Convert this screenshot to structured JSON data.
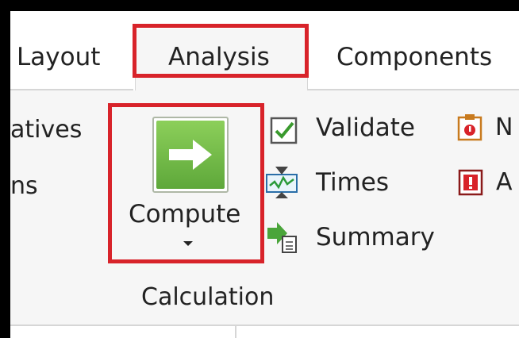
{
  "tabs": [
    {
      "label": "Layout",
      "icon": ""
    },
    {
      "label": "Analysis",
      "icon": ""
    },
    {
      "label": "Components",
      "icon": ""
    }
  ],
  "left_partial": [
    "atives",
    "ns"
  ],
  "compute": {
    "label": "Compute",
    "icon": "arrow-right-icon"
  },
  "group_label": "Calculation",
  "commands": {
    "validate": {
      "label": "Validate",
      "icon": "checkbox-check-icon"
    },
    "times": {
      "label": "Times",
      "icon": "timeline-chart-icon"
    },
    "summary": {
      "label": "Summary",
      "icon": "arrow-document-icon"
    }
  },
  "right_partial": [
    "N",
    "A"
  ],
  "colors": {
    "highlight": "#d8232a",
    "compute_green": "#6cbb45"
  }
}
